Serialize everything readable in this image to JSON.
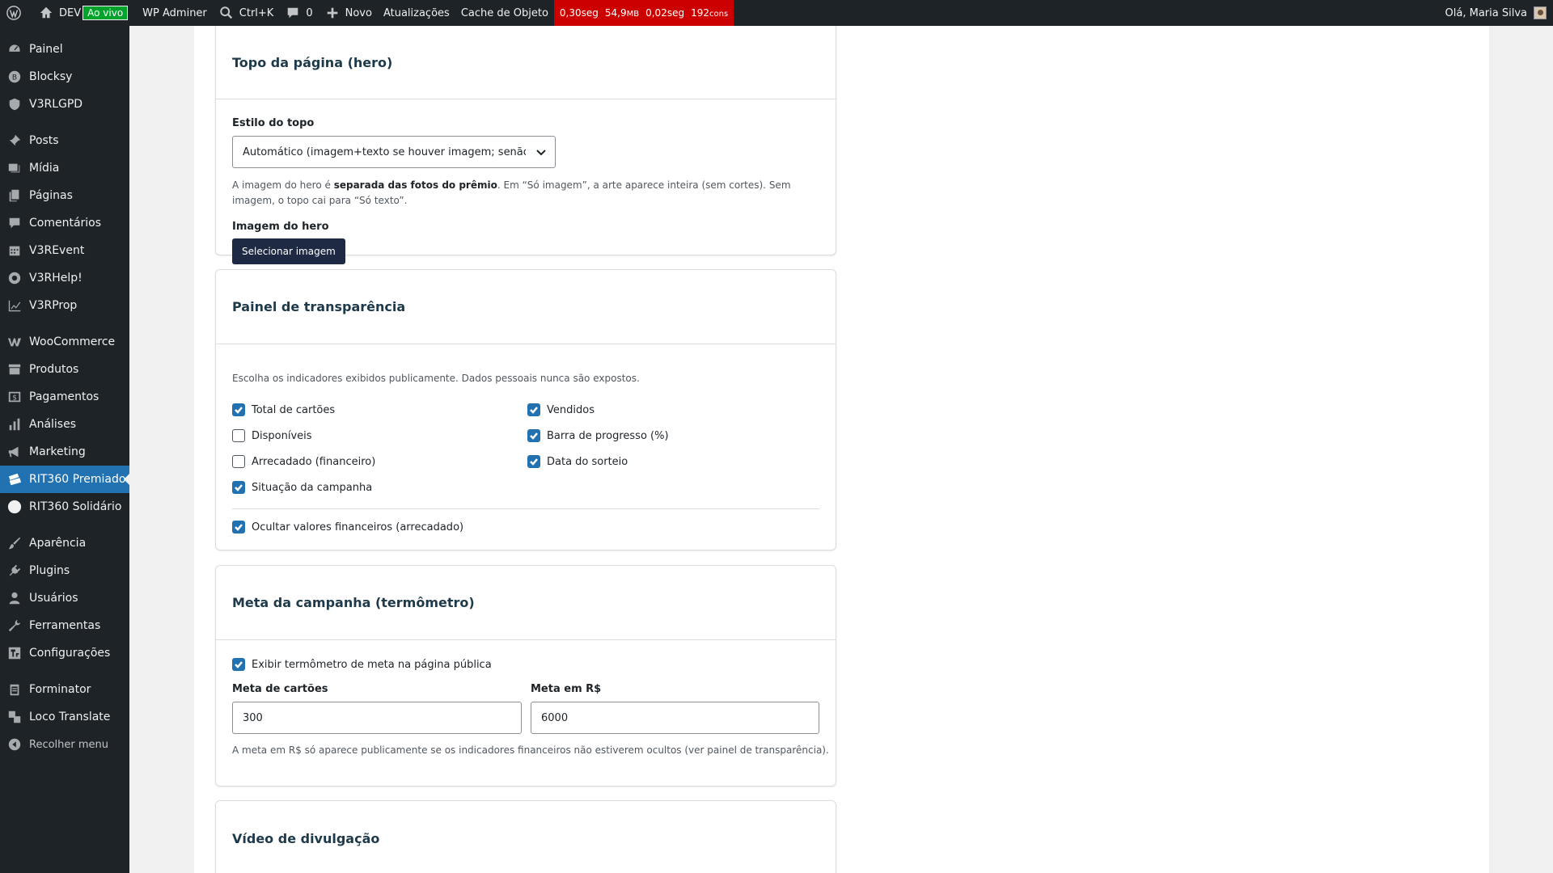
{
  "adminbar": {
    "site_name": "DEV",
    "live_badge": "Ao vivo",
    "adminer": "WP Adminer",
    "search_shortcut": "Ctrl+K",
    "comments_count": "0",
    "new_label": "Novo",
    "updates_label": "Atualizações",
    "cache_label": "Cache de Objeto",
    "qm": {
      "time": "0,30seg",
      "memory": "54,9",
      "memory_unit": "MB",
      "db_time": "0,02seg",
      "queries": "192",
      "queries_unit": "cons"
    },
    "greeting": "Olá, Maria Silva",
    "qm_color": "#cc0000"
  },
  "sidebar": {
    "items": [
      {
        "label": "Painel",
        "icon": "dashboard-icon"
      },
      {
        "label": "Blocksy",
        "icon": "blocksy-icon"
      },
      {
        "label": "V3RLGPD",
        "icon": "shield-icon"
      },
      {
        "label": "Posts",
        "icon": "pin-icon"
      },
      {
        "label": "Mídia",
        "icon": "media-icon"
      },
      {
        "label": "Páginas",
        "icon": "pages-icon"
      },
      {
        "label": "Comentários",
        "icon": "comment-icon"
      },
      {
        "label": "V3REvent",
        "icon": "calendar-icon"
      },
      {
        "label": "V3RHelp!",
        "icon": "lifebuoy-icon"
      },
      {
        "label": "V3RProp",
        "icon": "chart-line-icon"
      },
      {
        "label": "WooCommerce",
        "icon": "woo-icon"
      },
      {
        "label": "Produtos",
        "icon": "archive-icon"
      },
      {
        "label": "Pagamentos",
        "icon": "dollar-icon"
      },
      {
        "label": "Análises",
        "icon": "bar-chart-icon"
      },
      {
        "label": "Marketing",
        "icon": "megaphone-icon"
      },
      {
        "label": "RIT360 Premiado",
        "icon": "tickets-icon"
      },
      {
        "label": "RIT360 Solidário",
        "icon": "circle-icon"
      },
      {
        "label": "Aparência",
        "icon": "brush-icon"
      },
      {
        "label": "Plugins",
        "icon": "plugin-icon"
      },
      {
        "label": "Usuários",
        "icon": "user-icon"
      },
      {
        "label": "Ferramentas",
        "icon": "wrench-icon"
      },
      {
        "label": "Configurações",
        "icon": "settings-icon"
      },
      {
        "label": "Forminator",
        "icon": "clipboard-icon"
      },
      {
        "label": "Loco Translate",
        "icon": "translate-icon"
      },
      {
        "label": "Recolher menu",
        "icon": "collapse-icon"
      }
    ],
    "active_color": "#2271b1"
  },
  "hero": {
    "title": "Topo da página (hero)",
    "style_label": "Estilo do topo",
    "style_value": "Automático (imagem+texto se houver imagem; senão só texto)",
    "help_prefix": "A imagem do hero é ",
    "help_bold": "separada das fotos do prêmio",
    "help_suffix": ". Em “Só imagem”, a arte aparece inteira (sem cortes). Sem imagem, o topo cai para “Só texto”.",
    "image_label": "Imagem do hero",
    "select_image_button": "Selecionar imagem"
  },
  "transparency": {
    "title": "Painel de transparência",
    "help": "Escolha os indicadores exibidos publicamente. Dados pessoais nunca são expostos.",
    "left": [
      {
        "label": "Total de cartões",
        "checked": true
      },
      {
        "label": "Disponíveis",
        "checked": false
      },
      {
        "label": "Arrecadado (financeiro)",
        "checked": false
      },
      {
        "label": "Situação da campanha",
        "checked": true
      }
    ],
    "right": [
      {
        "label": "Vendidos",
        "checked": true
      },
      {
        "label": "Barra de progresso (%)",
        "checked": true
      },
      {
        "label": "Data do sorteio",
        "checked": true
      }
    ],
    "hide_financial": {
      "label": "Ocultar valores financeiros (arrecadado)",
      "checked": true
    }
  },
  "goal": {
    "title": "Meta da campanha (termômetro)",
    "show_thermometer": {
      "label": "Exibir termômetro de meta na página pública",
      "checked": true
    },
    "cards_label": "Meta de cartões",
    "cards_value": "300",
    "money_label": "Meta em R$",
    "money_value": "6000",
    "help": "A meta em R$ só aparece publicamente se os indicadores financeiros não estiverem ocultos (ver painel de transparência)."
  },
  "video": {
    "title": "Vídeo de divulgação"
  }
}
